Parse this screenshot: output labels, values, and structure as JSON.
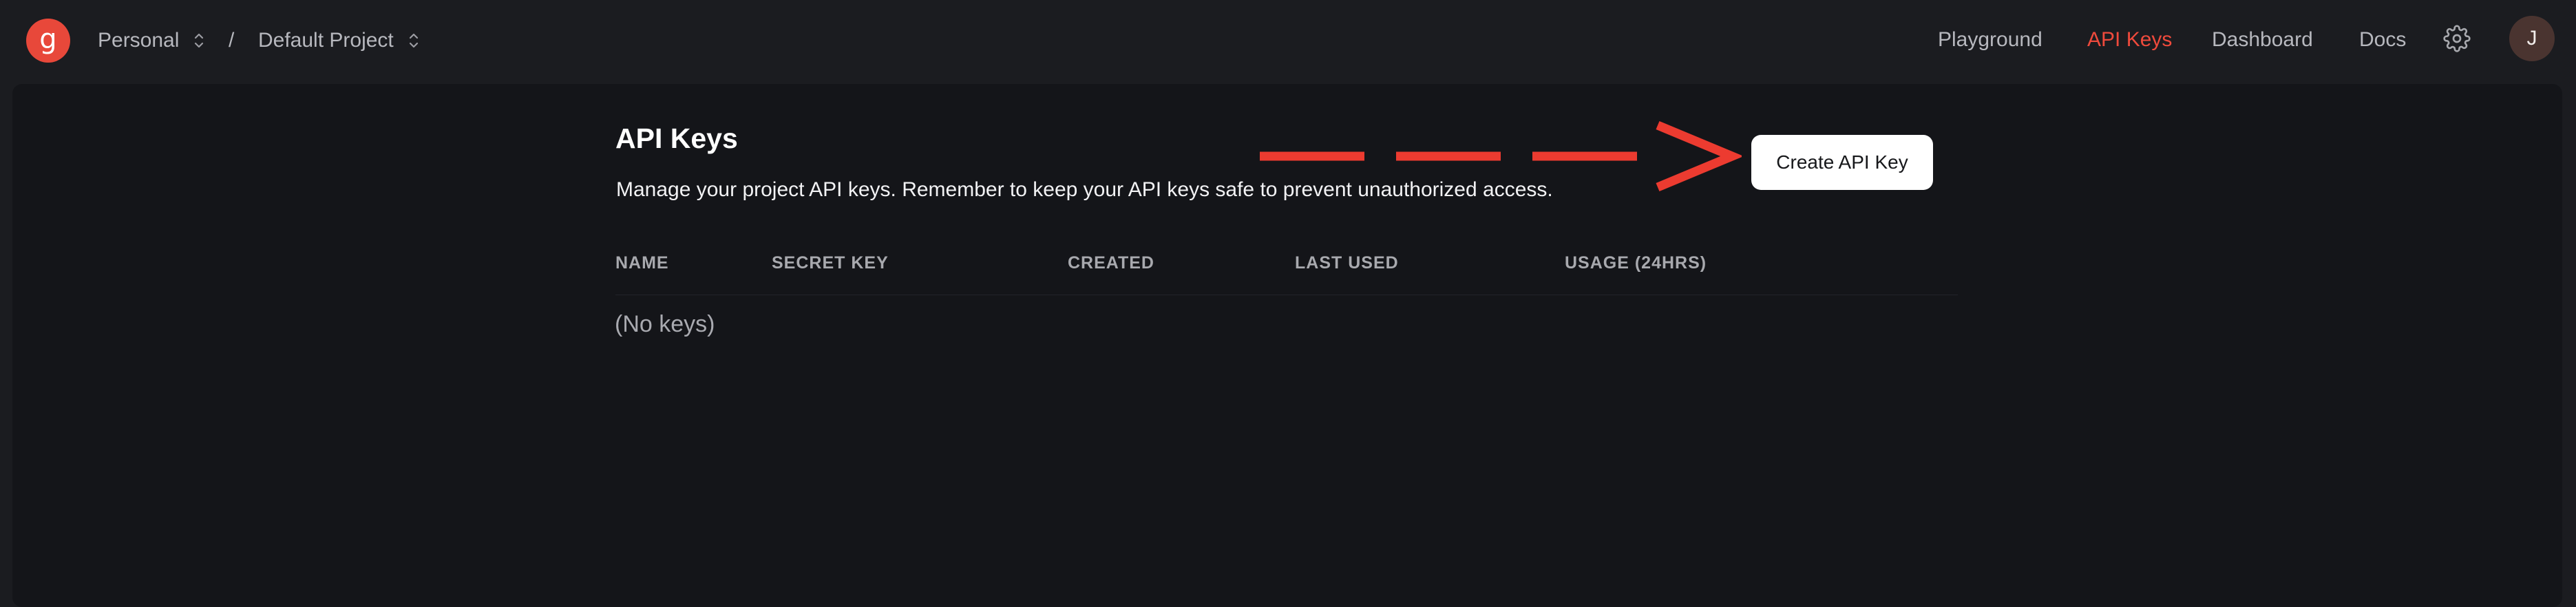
{
  "header": {
    "logo_glyph": "g",
    "breadcrumb": {
      "workspace": "Personal",
      "separator": "/",
      "project": "Default Project"
    },
    "nav": {
      "playground": "Playground",
      "api_keys": "API Keys",
      "dashboard": "Dashboard",
      "docs": "Docs"
    },
    "avatar_initial": "J"
  },
  "main": {
    "title": "API Keys",
    "description": "Manage your project API keys. Remember to keep your API keys safe to prevent unauthorized access.",
    "create_button": "Create API Key",
    "table": {
      "columns": [
        "NAME",
        "SECRET KEY",
        "CREATED",
        "LAST USED",
        "USAGE (24HRS)"
      ],
      "empty_text": "(No keys)"
    }
  },
  "colors": {
    "accent": "#ef4a3c",
    "background": "#1b1c20",
    "panel": "#141519",
    "annotation_arrow": "#ec3b30"
  },
  "icons": {
    "logo": "brand-logo-icon",
    "breadcrumb_chevron": "chevron-up-down-icon",
    "settings": "gear-icon"
  }
}
